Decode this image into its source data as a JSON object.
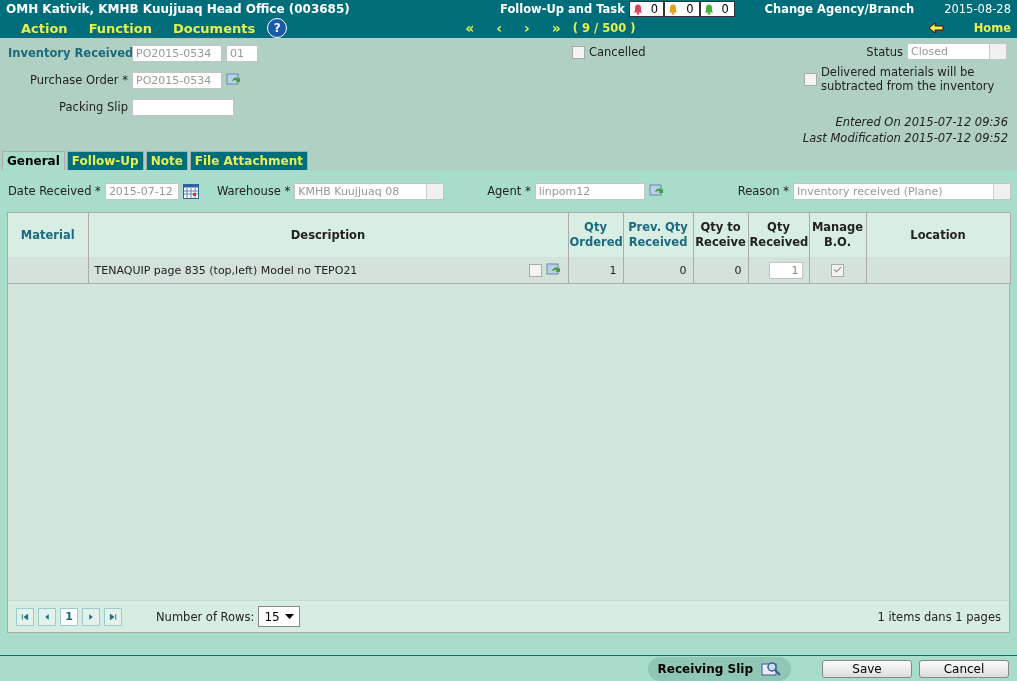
{
  "header": {
    "title": "OMH Kativik, KMHB Kuujjuaq Head Office (003685)",
    "follow_up_label": "Follow-Up and Task",
    "bells": [
      {
        "color": "#e0405a",
        "count": "0"
      },
      {
        "color": "#e0a020",
        "count": "0"
      },
      {
        "color": "#40b030",
        "count": "0"
      }
    ],
    "change_agency": "Change Agency/Branch",
    "date": "2015-08-28",
    "menu": [
      "Action",
      "Function",
      "Documents"
    ],
    "help": "?",
    "nav": [
      "«",
      "‹",
      "›",
      "»"
    ],
    "position": "( 9 / 500 )",
    "home": "Home"
  },
  "form": {
    "inventory_received": {
      "label": "Inventory Received",
      "value": "PO2015-0534",
      "suffix": "01"
    },
    "purchase_order": {
      "label": "Purchase Order *",
      "value": "PO2015-0534"
    },
    "packing_slip": {
      "label": "Packing Slip"
    },
    "cancelled": {
      "label": "Cancelled",
      "checked": false
    },
    "status": {
      "label": "Status",
      "value": "Closed"
    },
    "delivered": {
      "label": "Delivered materials will be subtracted from the inventory",
      "checked": false
    },
    "entered_on": "Entered On 2015-07-12 09:36",
    "last_modification": "Last Modification 2015-07-12 09:52"
  },
  "tabs": [
    {
      "label": "General",
      "selected": true
    },
    {
      "label": "Follow-Up",
      "selected": false
    },
    {
      "label": "Note",
      "selected": false
    },
    {
      "label": "File Attachment",
      "selected": false
    }
  ],
  "filters": [
    {
      "kind": "date",
      "label": "Date Received *",
      "value": "2015-07-12"
    },
    {
      "kind": "select",
      "label": "Warehouse *",
      "value": "KMHB Kuujjuaq 08"
    },
    {
      "kind": "lookup",
      "label": "Agent *",
      "value": "linpom12"
    },
    {
      "kind": "select",
      "label": "Reason *",
      "value": "Inventory received (Plane)"
    }
  ],
  "table": {
    "columns": [
      {
        "label": "Material",
        "sortable": true
      },
      {
        "label": "Description",
        "sortable": false
      },
      {
        "label": "Qty Ordered",
        "sortable": true
      },
      {
        "label": "Prev. Qty Received",
        "sortable": true
      },
      {
        "label": "Qty to Receive",
        "sortable": false
      },
      {
        "label": "Qty Received",
        "sortable": false
      },
      {
        "label": "Manage B.O.",
        "sortable": false
      },
      {
        "label": "Location",
        "sortable": false
      }
    ],
    "rows": [
      {
        "description": "TENAQUIP page 835 (top,left) Model no TEPO21",
        "checked": false,
        "qty_ordered": "1",
        "prev_qty_received": "0",
        "qty_to_receive": "0",
        "qty_received": "1",
        "manage_bo": true
      }
    ]
  },
  "pager": {
    "pages": [
      {
        "label": "1",
        "selected": true
      }
    ],
    "rows_label": "Number of Rows:",
    "rows_value": "15",
    "summary": "1 items dans 1 pages"
  },
  "footer": {
    "receiving_slip": "Receiving Slip",
    "save": "Save",
    "cancel": "Cancel"
  }
}
